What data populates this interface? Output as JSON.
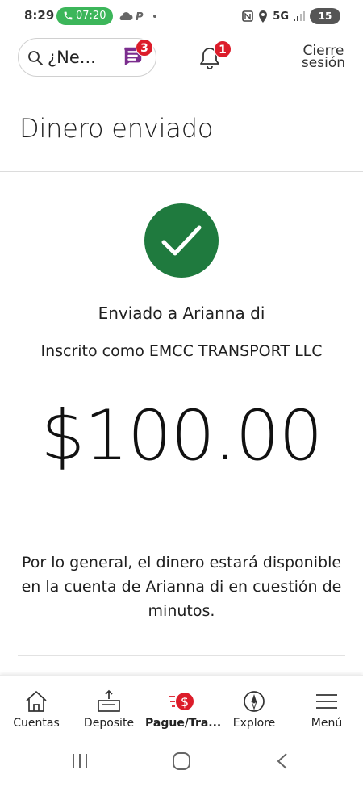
{
  "status_bar": {
    "time": "8:29",
    "call_timer": "07:20",
    "network": "5G",
    "battery": "15"
  },
  "header": {
    "search_text": "¿Ne...",
    "erica_badge_count": "3",
    "notification_badge_count": "1",
    "signout_line1": "Cierre",
    "signout_line2": "sesión"
  },
  "page": {
    "title": "Dinero enviado"
  },
  "confirmation": {
    "sent_to": "Enviado a Arianna di",
    "enrolled_as": "Inscrito como EMCC TRANSPORT LLC",
    "amount": "$100.00",
    "note": "Por lo general, el dinero estará disponible en la cuenta de Arianna di en cuestión de minutos."
  },
  "tabs": [
    {
      "label": "Cuentas",
      "icon": "home-icon"
    },
    {
      "label": "Deposite",
      "icon": "deposit-icon"
    },
    {
      "label": "Pague/Tra...",
      "icon": "pay-transfer-icon",
      "active": true
    },
    {
      "label": "Explore",
      "icon": "compass-icon"
    },
    {
      "label": "Menú",
      "icon": "hamburger-icon"
    }
  ],
  "colors": {
    "success_green": "#1f7a3e",
    "badge_red": "#dc1c2a",
    "call_green": "#3cb65a",
    "brand_purple": "#7b2d8e"
  }
}
